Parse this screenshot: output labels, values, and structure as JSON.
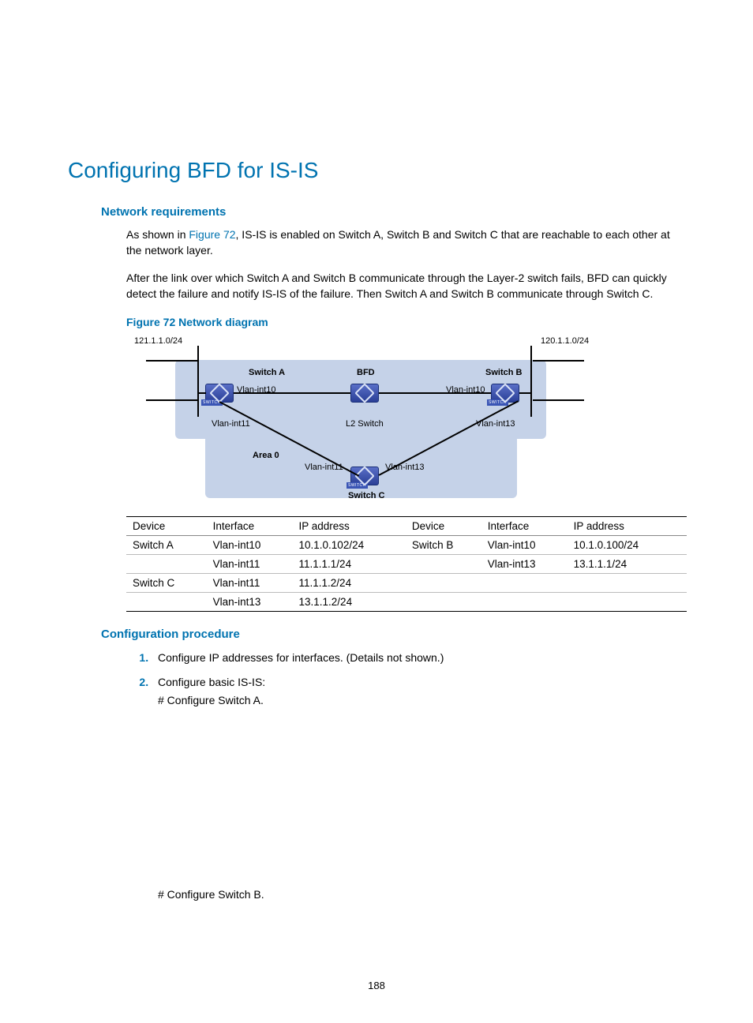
{
  "page_number": "188",
  "title": "Configuring BFD for IS-IS",
  "section_net_req": "Network requirements",
  "para1_pre": "As shown in ",
  "para1_ref": "Figure 72",
  "para1_post": ", IS-IS is enabled on Switch A, Switch B and Switch C that are reachable to each other at the network layer.",
  "para2": "After the link over which Switch A and Switch B communicate through the Layer-2 switch fails, BFD can quickly detect the failure and notify IS-IS of the failure. Then Switch A and Switch B communicate through Switch C.",
  "figure_caption": "Figure 72 Network diagram",
  "diagram": {
    "net_a": "121.1.1.0/24",
    "net_b": "120.1.1.0/24",
    "switch_a": "Switch A",
    "switch_b": "Switch B",
    "switch_c": "Switch C",
    "bfd": "BFD",
    "l2": "L2 Switch",
    "area0": "Area 0",
    "v10": "Vlan-int10",
    "v11": "Vlan-int11",
    "v13": "Vlan-int13"
  },
  "table": {
    "headers": [
      "Device",
      "Interface",
      "IP address",
      "Device",
      "Interface",
      "IP address"
    ],
    "rows": [
      [
        "Switch A",
        "Vlan-int10",
        "10.1.0.102/24",
        "Switch B",
        "Vlan-int10",
        "10.1.0.100/24"
      ],
      [
        "",
        "Vlan-int11",
        "11.1.1.1/24",
        "",
        "Vlan-int13",
        "13.1.1.1/24"
      ],
      [
        "Switch C",
        "Vlan-int11",
        "11.1.1.2/24",
        "",
        "",
        ""
      ],
      [
        "",
        "Vlan-int13",
        "13.1.1.2/24",
        "",
        "",
        ""
      ]
    ]
  },
  "section_conf": "Configuration procedure",
  "proc": {
    "step1": "Configure IP addresses for interfaces. (Details not shown.)",
    "step2": "Configure basic IS-IS:",
    "step2a": "# Configure Switch A.",
    "step2b": "# Configure Switch B."
  }
}
